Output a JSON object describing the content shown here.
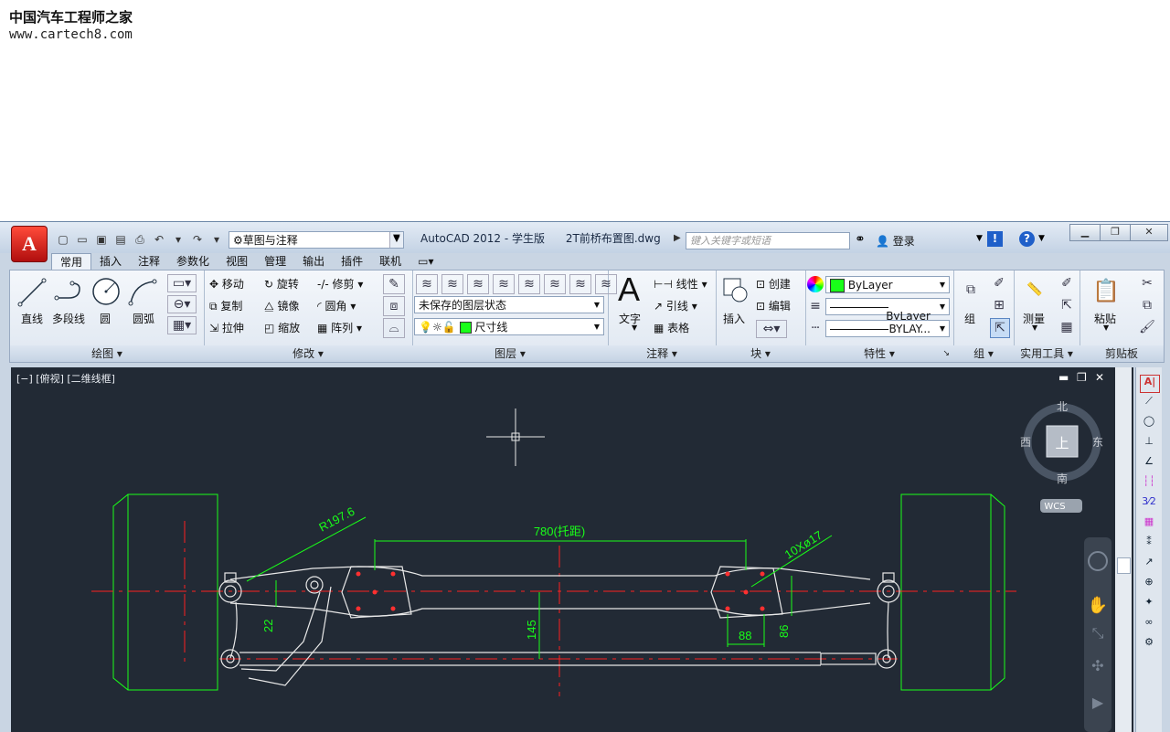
{
  "watermark": {
    "line1": "中国汽车工程师之家",
    "line2": "www.cartech8.com"
  },
  "titlebar": {
    "logo": "A",
    "workspace": "草图与注释",
    "title": "AutoCAD 2012 - 学生版",
    "file": "2T前桥布置图.dwg",
    "search_placeholder": "键入关键字或短语",
    "login": "登录"
  },
  "tabs": [
    "常用",
    "插入",
    "注释",
    "参数化",
    "视图",
    "管理",
    "输出",
    "插件",
    "联机"
  ],
  "ribbon": {
    "draw": {
      "title": "绘图",
      "items": [
        "直线",
        "多段线",
        "圆",
        "圆弧"
      ]
    },
    "modify": {
      "title": "修改",
      "items": [
        "移动",
        "旋转",
        "修剪",
        "复制",
        "镜像",
        "圆角",
        "拉伸",
        "缩放",
        "阵列"
      ]
    },
    "layer": {
      "title": "图层",
      "state": "未保存的图层状态",
      "current": "尺寸线"
    },
    "annot": {
      "title": "注释",
      "text": "文字",
      "items": [
        "线性",
        "引线",
        "表格"
      ]
    },
    "block": {
      "title": "块",
      "insert": "插入",
      "items": [
        "创建",
        "编辑"
      ]
    },
    "props": {
      "title": "特性",
      "color": "ByLayer",
      "lineweight": "ByLayer",
      "linetype": "BYLAY..."
    },
    "group": {
      "title": "组",
      "label": "组"
    },
    "util": {
      "title": "实用工具",
      "label": "测量"
    },
    "clip": {
      "title": "剪贴板",
      "label": "粘贴"
    }
  },
  "viewport": {
    "label": "[−] [俯视] [二维线框]",
    "compass": {
      "north": "北",
      "south": "南",
      "east": "东",
      "west": "西",
      "top": "上"
    },
    "wcs": "WCS"
  },
  "drawing": {
    "dim_center": "780(托距)",
    "dim_radius": "R197.6",
    "dim_holes": "10Xø17",
    "dim_left": "22",
    "dim_mid": "145",
    "dim_bot": "88",
    "dim_right": "86"
  },
  "colors": {
    "canvas": "#222a35",
    "green": "#19ff19",
    "red": "#ff2020",
    "white": "#e8e8e8"
  }
}
